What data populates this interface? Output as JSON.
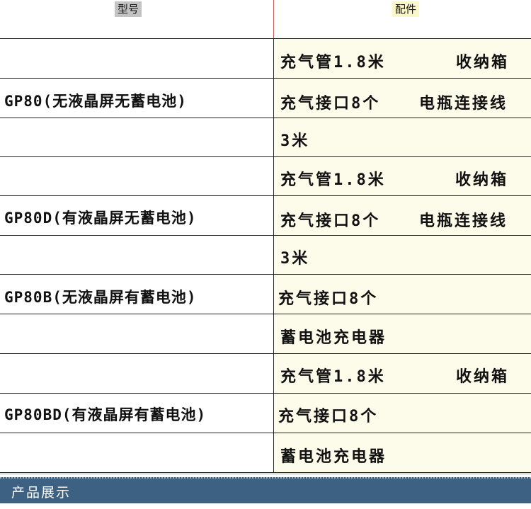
{
  "header": {
    "model": "型号",
    "parts": "配件"
  },
  "groups": [
    {
      "model": "GP80(无液晶屏无蓄电池)",
      "lines": [
        {
          "left": "充气管1.8米",
          "right": "收纳箱"
        },
        {
          "left": "充气接口8个",
          "right": "电瓶连接线"
        },
        {
          "left": "3米",
          "right": ""
        }
      ]
    },
    {
      "model": "GP80D(有液晶屏无蓄电池)",
      "lines": [
        {
          "left": "充气管1.8米",
          "right": "收纳箱"
        },
        {
          "left": "充气接口8个",
          "right": "电瓶连接线"
        },
        {
          "left": "3米",
          "right": ""
        }
      ]
    },
    {
      "model": "GP80B(无液晶屏有蓄电池)",
      "lines": [
        {
          "left": "充气接口8个",
          "right": ""
        },
        {
          "left": "蓄电池充电器",
          "right": ""
        }
      ]
    },
    {
      "model": "GP80BD(有液晶屏有蓄电池)",
      "lines": [
        {
          "left": "充气管1.8米",
          "right": "收纳箱"
        },
        {
          "left": "充气接口8个",
          "right": ""
        },
        {
          "left": "蓄电池充电器",
          "right": ""
        }
      ]
    }
  ],
  "banner": {
    "title": "产品展示"
  }
}
